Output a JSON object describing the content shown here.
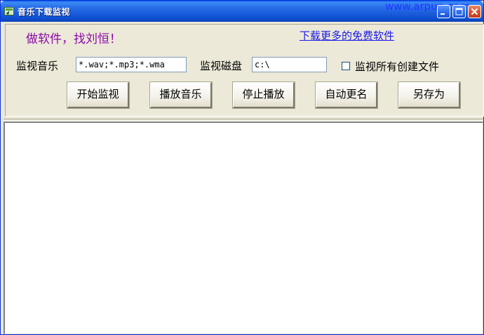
{
  "window": {
    "title": "音乐下载监视",
    "watermark": "www.arpun.com",
    "controls": {
      "minimize": "minimize-icon",
      "maximize": "maximize-icon",
      "close": "close-icon"
    }
  },
  "header": {
    "slogan": "做软件，找刘恒！",
    "download_link": "下载更多的免费软件"
  },
  "form": {
    "music_label": "监视音乐",
    "music_value": "*.wav;*.mp3;*.wma",
    "disk_label": "监视磁盘",
    "disk_value": "c:\\",
    "all_files_label": "监视所有创建文件",
    "all_files_checked": false
  },
  "buttons": {
    "start": "开始监视",
    "play": "播放音乐",
    "stop": "停止播放",
    "rename": "自动更名",
    "save_as": "另存为"
  },
  "list": {
    "items": []
  },
  "colors": {
    "titlebar": "#0A5FE8",
    "slogan": "#8B0AA8",
    "link": "#1A1AE8",
    "window_bg": "#ECE9D8"
  }
}
